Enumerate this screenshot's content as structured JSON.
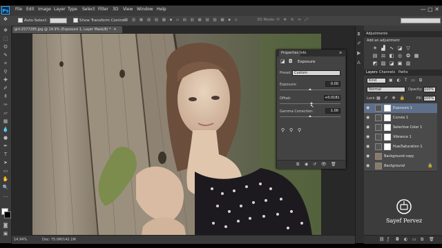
{
  "app": {
    "logo": "Ps",
    "menus": [
      "File",
      "Edit",
      "Image",
      "Layer",
      "Type",
      "Select",
      "Filter",
      "3D",
      "View",
      "Window",
      "Help"
    ],
    "window_controls": "—  ▢  ✕"
  },
  "options_bar": {
    "auto_select_label": "Auto-Select:",
    "auto_select_value": "Group",
    "transform_controls_label": "Show Transform Controls",
    "mode_label": "3D Mode:",
    "workspace": "Photography"
  },
  "document": {
    "tab_title": "girl-2577285.jpg @ 14.9% (Exposure 1, Layer Mask/8) *",
    "zoom": "14.94%",
    "doc_size": "Doc: 75.0M/142.1M"
  },
  "properties_panel": {
    "tabs": [
      "Properties",
      "Info"
    ],
    "title": "Exposure",
    "preset_label": "Preset:",
    "preset_value": "Custom",
    "exposure_label": "Exposure:",
    "exposure_value": "0.00",
    "offset_label": "Offset:",
    "offset_value": "+0.0181",
    "gamma_label": "Gamma Correction:",
    "gamma_value": "1.00",
    "exposure_level": 0.5,
    "offset_level": 0.52,
    "gamma_level": 0.5
  },
  "adjustments_panel": {
    "title": "Adjustments",
    "subtitle": "Add an adjustment"
  },
  "layers_panel": {
    "tabs": [
      "Layers",
      "Channels",
      "Paths"
    ],
    "filter_kind": "Kind",
    "blend_mode": "Normal",
    "opacity_label": "Opacity:",
    "opacity_value": "100%",
    "lock_label": "Lock:",
    "fill_label": "Fill:",
    "fill_value": "100%",
    "layers": [
      {
        "name": "Exposure 1",
        "selected": true
      },
      {
        "name": "Curves 1",
        "selected": false
      },
      {
        "name": "Selective Color 1",
        "selected": false
      },
      {
        "name": "Vibrance 1",
        "selected": false
      },
      {
        "name": "Hue/Saturation 1",
        "selected": false
      },
      {
        "name": "Background copy",
        "selected": false
      },
      {
        "name": "Background",
        "selected": false
      }
    ]
  },
  "branding": {
    "name": "Sayef Pervez"
  },
  "colors": {
    "accent": "#31a8ff",
    "panel": "#3c3c3c",
    "selected_layer": "#5e6f8a"
  }
}
